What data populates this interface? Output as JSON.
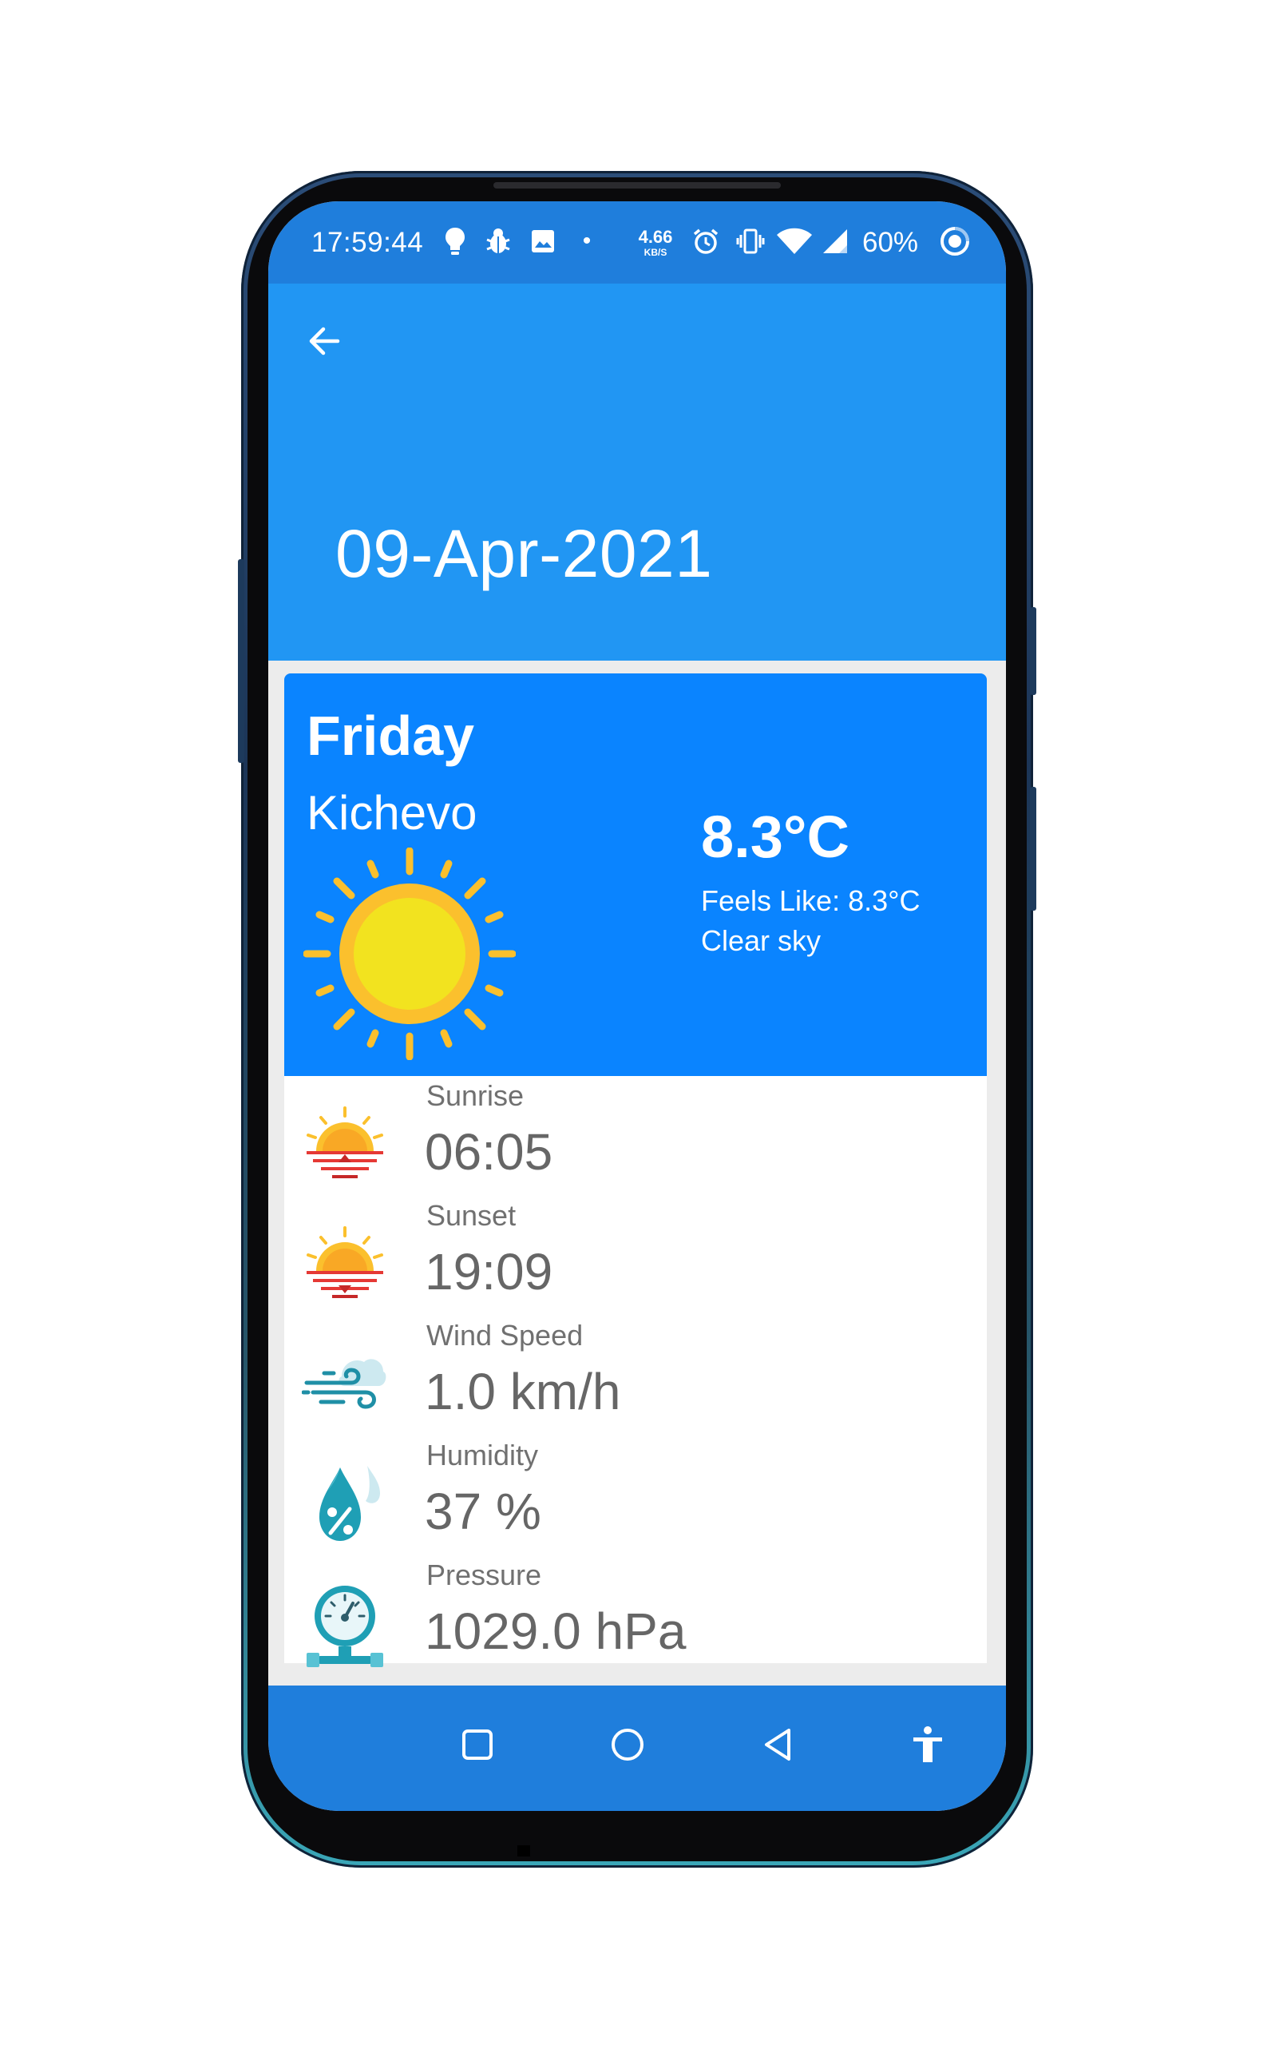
{
  "status_bar": {
    "time": "17:59:44",
    "net_speed_value": "4.66",
    "net_speed_unit": "KB/S",
    "dot": "•",
    "battery": "60%",
    "icons": [
      "lightbulb-icon",
      "bug-icon",
      "image-icon",
      "notification-dot",
      "alarm-icon",
      "vibrate-icon",
      "wifi-icon",
      "signal-icon",
      "battery-saver-icon"
    ]
  },
  "app_bar": {
    "back_icon": "arrow-back-icon",
    "date": "09-Apr-2021"
  },
  "today": {
    "day": "Friday",
    "city": "Kichevo",
    "temperature": "8.3°C",
    "feels_like": "Feels Like: 8.3°C",
    "condition": "Clear sky",
    "icon": "sun-icon"
  },
  "details": [
    {
      "label": "Sunrise",
      "value": "06:05",
      "icon": "sunrise-icon"
    },
    {
      "label": "Sunset",
      "value": "19:09",
      "icon": "sunset-icon"
    },
    {
      "label": "Wind Speed",
      "value": "1.0 km/h",
      "icon": "wind-icon"
    },
    {
      "label": "Humidity",
      "value": "37 %",
      "icon": "humidity-icon"
    },
    {
      "label": "Pressure",
      "value": "1029.0 hPa",
      "icon": "pressure-gauge-icon"
    }
  ],
  "nav_bar": {
    "buttons": [
      "recents-icon",
      "home-icon",
      "back-triangle-icon",
      "accessibility-icon"
    ]
  },
  "colors": {
    "status_bar": "#1f7edc",
    "app_bar": "#2196f3",
    "card": "#0a84ff",
    "sun_yellow": "#fbc02d",
    "detail_text": "#666666"
  }
}
